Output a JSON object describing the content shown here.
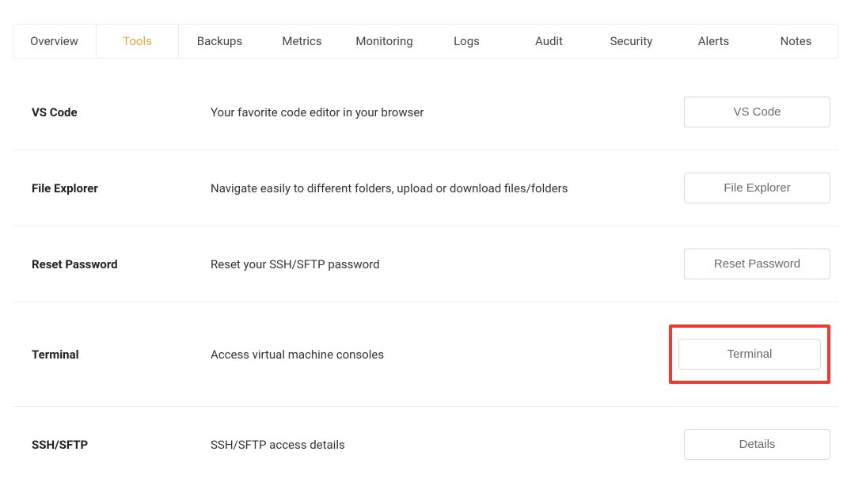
{
  "tabs": [
    {
      "label": "Overview",
      "active": false
    },
    {
      "label": "Tools",
      "active": true
    },
    {
      "label": "Backups",
      "active": false
    },
    {
      "label": "Metrics",
      "active": false
    },
    {
      "label": "Monitoring",
      "active": false
    },
    {
      "label": "Logs",
      "active": false
    },
    {
      "label": "Audit",
      "active": false
    },
    {
      "label": "Security",
      "active": false
    },
    {
      "label": "Alerts",
      "active": false
    },
    {
      "label": "Notes",
      "active": false
    }
  ],
  "rows": [
    {
      "title": "VS Code",
      "desc": "Your favorite code editor in your browser",
      "button": "VS Code",
      "highlighted": false
    },
    {
      "title": "File Explorer",
      "desc": "Navigate easily to different folders, upload or download files/folders",
      "button": "File Explorer",
      "highlighted": false
    },
    {
      "title": "Reset Password",
      "desc": "Reset your SSH/SFTP password",
      "button": "Reset Password",
      "highlighted": false
    },
    {
      "title": "Terminal",
      "desc": "Access virtual machine consoles",
      "button": "Terminal",
      "highlighted": true
    },
    {
      "title": "SSH/SFTP",
      "desc": "SSH/SFTP access details",
      "button": "Details",
      "highlighted": false
    }
  ]
}
